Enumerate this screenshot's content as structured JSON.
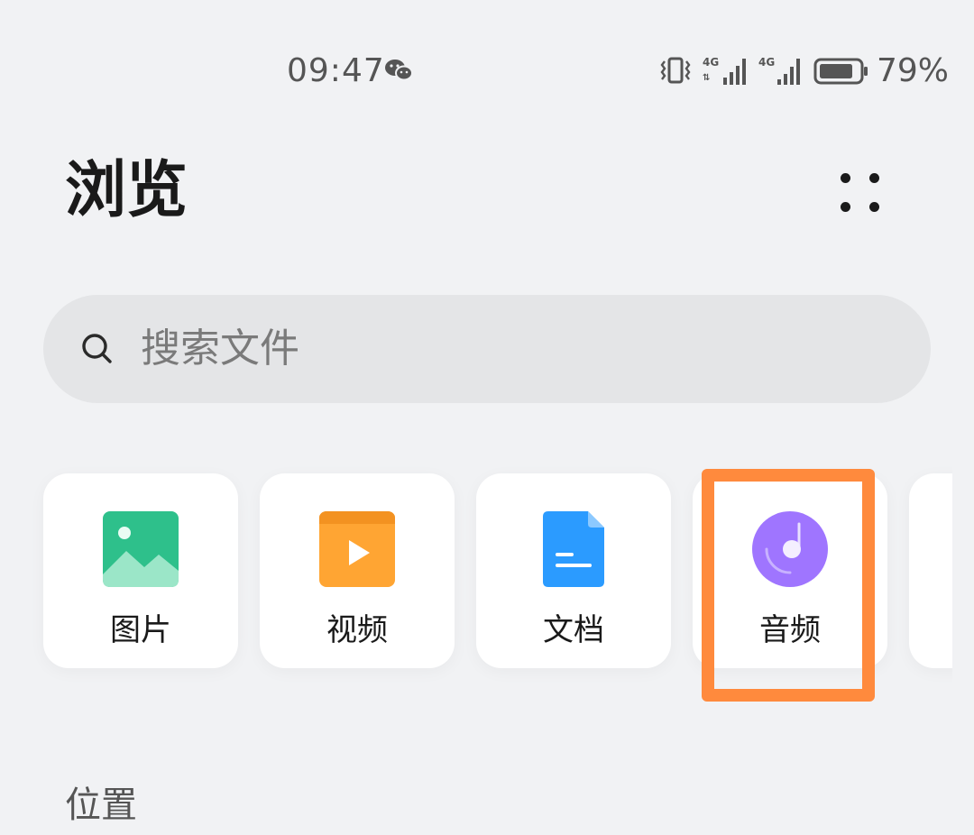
{
  "status_bar": {
    "time": "09:47",
    "battery": "79%",
    "signal_1_label": "4G",
    "signal_2_label": "4G",
    "icons": [
      "wechat-icon",
      "vibrate-icon",
      "signal-icon",
      "signal-icon",
      "battery-icon"
    ]
  },
  "header": {
    "title": "浏览",
    "more_icon": "more-dots-icon"
  },
  "search": {
    "placeholder": "搜索文件",
    "icon": "search-icon"
  },
  "categories": [
    {
      "label": "图片",
      "icon": "image-icon",
      "color": "#2ec08b"
    },
    {
      "label": "视频",
      "icon": "video-icon",
      "color": "#ffa533"
    },
    {
      "label": "文档",
      "icon": "document-icon",
      "color": "#2b9bff"
    },
    {
      "label": "音频",
      "icon": "audio-icon",
      "color": "#9f75ff",
      "highlighted": true
    }
  ],
  "highlight_color": "#ff8a3d",
  "section": {
    "heading": "位置"
  }
}
